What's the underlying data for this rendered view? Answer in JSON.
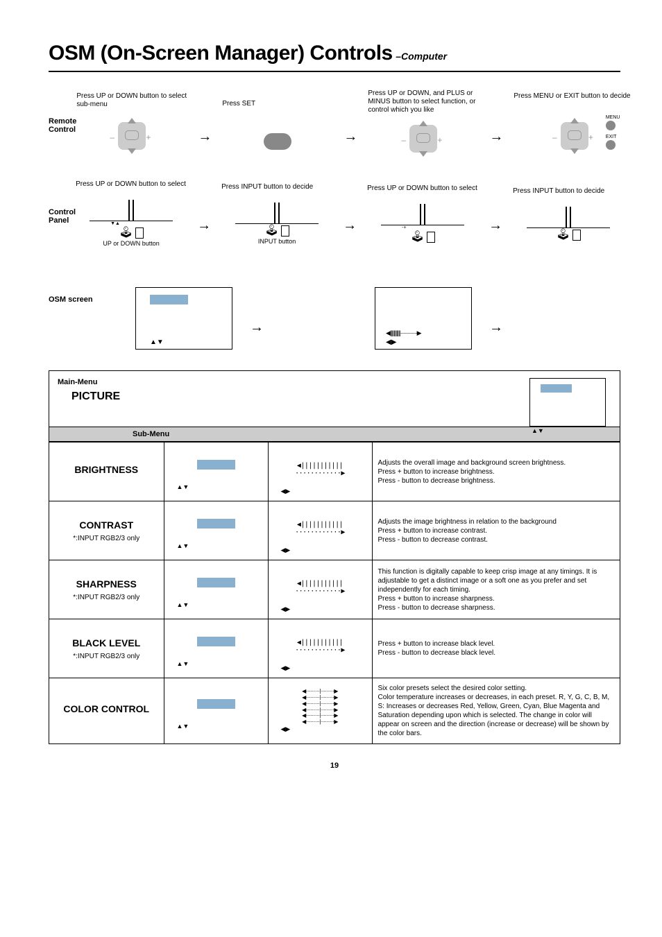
{
  "title": {
    "main": "OSM (On-Screen Manager) Controls",
    "subtitle": "–Computer"
  },
  "flows": {
    "remote": {
      "label": "Remote Control",
      "step1": "Press UP or DOWN button to select sub-menu",
      "step2": "Press SET",
      "step3": "Press UP or DOWN, and PLUS or MINUS button to select function, or control which you like",
      "step4": "Press MENU or EXIT button to decide",
      "menu_label": "MENU",
      "exit_label": "EXIT",
      "minus": "–",
      "plus": "+"
    },
    "panel": {
      "label": "Control Panel",
      "step1": "Press UP or DOWN button to select",
      "step2": "Press INPUT button to decide",
      "step3": "Press UP or DOWN button to select",
      "step4": "Press INPUT button to decide",
      "btn1": "UP or DOWN button",
      "btn2": "INPUT button"
    },
    "osm": {
      "label": "OSM screen"
    }
  },
  "menu": {
    "main_label": "Main-Menu",
    "main_name": "PICTURE",
    "sub_label": "Sub-Menu",
    "av": "▲▼",
    "lr": "◀▶",
    "slider": "◀|||||||||||············▶",
    "multi_slider_line": "◀·········|·········▶",
    "rows": [
      {
        "name": "BRIGHTNESS",
        "note": "",
        "desc": "Adjusts the overall image and background screen brightness.\nPress + button to increase brightness.\nPress - button to decrease brightness."
      },
      {
        "name": "CONTRAST",
        "note": "*:INPUT RGB2/3 only",
        "desc": "Adjusts the image brightness in relation to the background\nPress + button to increase contrast.\nPress - button to decrease contrast."
      },
      {
        "name": "SHARPNESS",
        "note": "*:INPUT RGB2/3 only",
        "desc": "This function is digitally capable to keep crisp image at any timings.  It is adjustable to get a distinct image or a soft one as you prefer and set independently for each timing.\nPress + button to increase sharpness.\nPress - button to decrease sharpness."
      },
      {
        "name": "BLACK LEVEL",
        "note": "*:INPUT RGB2/3 only",
        "desc": "Press + button to increase black level.\nPress - button to decrease black level."
      },
      {
        "name": "COLOR CONTROL",
        "note": "",
        "desc": "Six color presets select the desired color setting.\nColor temperature increases or decreases, in each preset.  R, Y, G, C, B, M, S:  Increases or decreases Red, Yellow, Green, Cyan, Blue Magenta and Saturation depending upon which is selected.  The change in color will appear on screen and the direction (increase or decrease) will be shown by the color bars."
      }
    ]
  },
  "page": "19"
}
